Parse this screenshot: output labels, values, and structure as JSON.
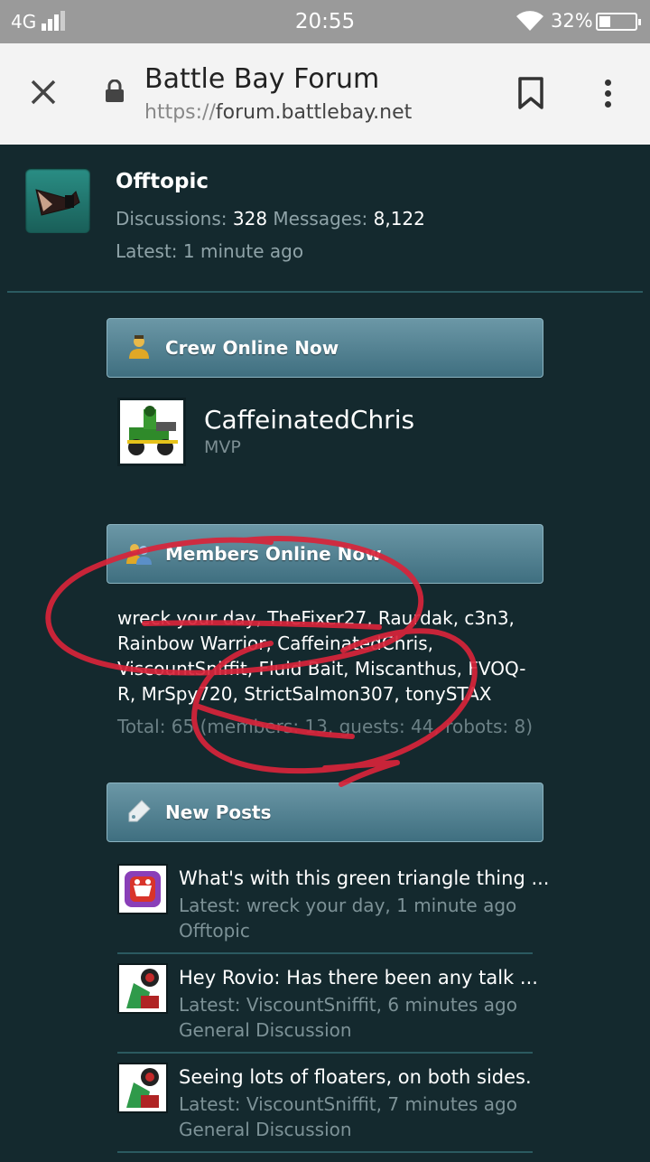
{
  "status_bar": {
    "network": "4G",
    "time": "20:55",
    "battery_percent": "32%",
    "battery_level": 0.32
  },
  "browser": {
    "page_title": "Battle Bay Forum",
    "url_scheme": "https://",
    "url_host": "forum.battlebay.net"
  },
  "forum": {
    "title": "Offtopic",
    "discussions_label": "Discussions:",
    "discussions": "328",
    "messages_label": "Messages:",
    "messages": "8,122",
    "latest": "Latest: 1 minute ago"
  },
  "crew_panel": {
    "heading": "Crew Online Now",
    "member_name": "CaffeinatedChris",
    "member_rank": "MVP"
  },
  "members_panel": {
    "heading": "Members Online Now",
    "list": "wreck your day, TheFixer27, Raurdak, c3n3, Rainbow Warrior, CaffeinatedChris, ViscountSniffit, Fluid Bait, Miscanthus, FVOQ-R, MrSpy720, StrictSalmon307, tonySTAX",
    "total": "Total: 65 (members: 13, guests: 44, robots: 8)"
  },
  "new_posts_panel": {
    "heading": "New Posts",
    "posts": [
      {
        "title": "What's with this green triangle thing ...",
        "latest": "Latest: wreck your day, 1 minute ago",
        "forum": "Offtopic"
      },
      {
        "title": "Hey Rovio: Has there been any talk ...",
        "latest": "Latest: ViscountSniffit, 6 minutes ago",
        "forum": "General Discussion"
      },
      {
        "title": "Seeing lots of floaters, on both sides.",
        "latest": "Latest: ViscountSniffit, 7 minutes ago",
        "forum": "General Discussion"
      }
    ]
  },
  "colors": {
    "page_bg": "#14292e",
    "panel_header": "#4f7f8f",
    "annotation": "#d8243a"
  }
}
